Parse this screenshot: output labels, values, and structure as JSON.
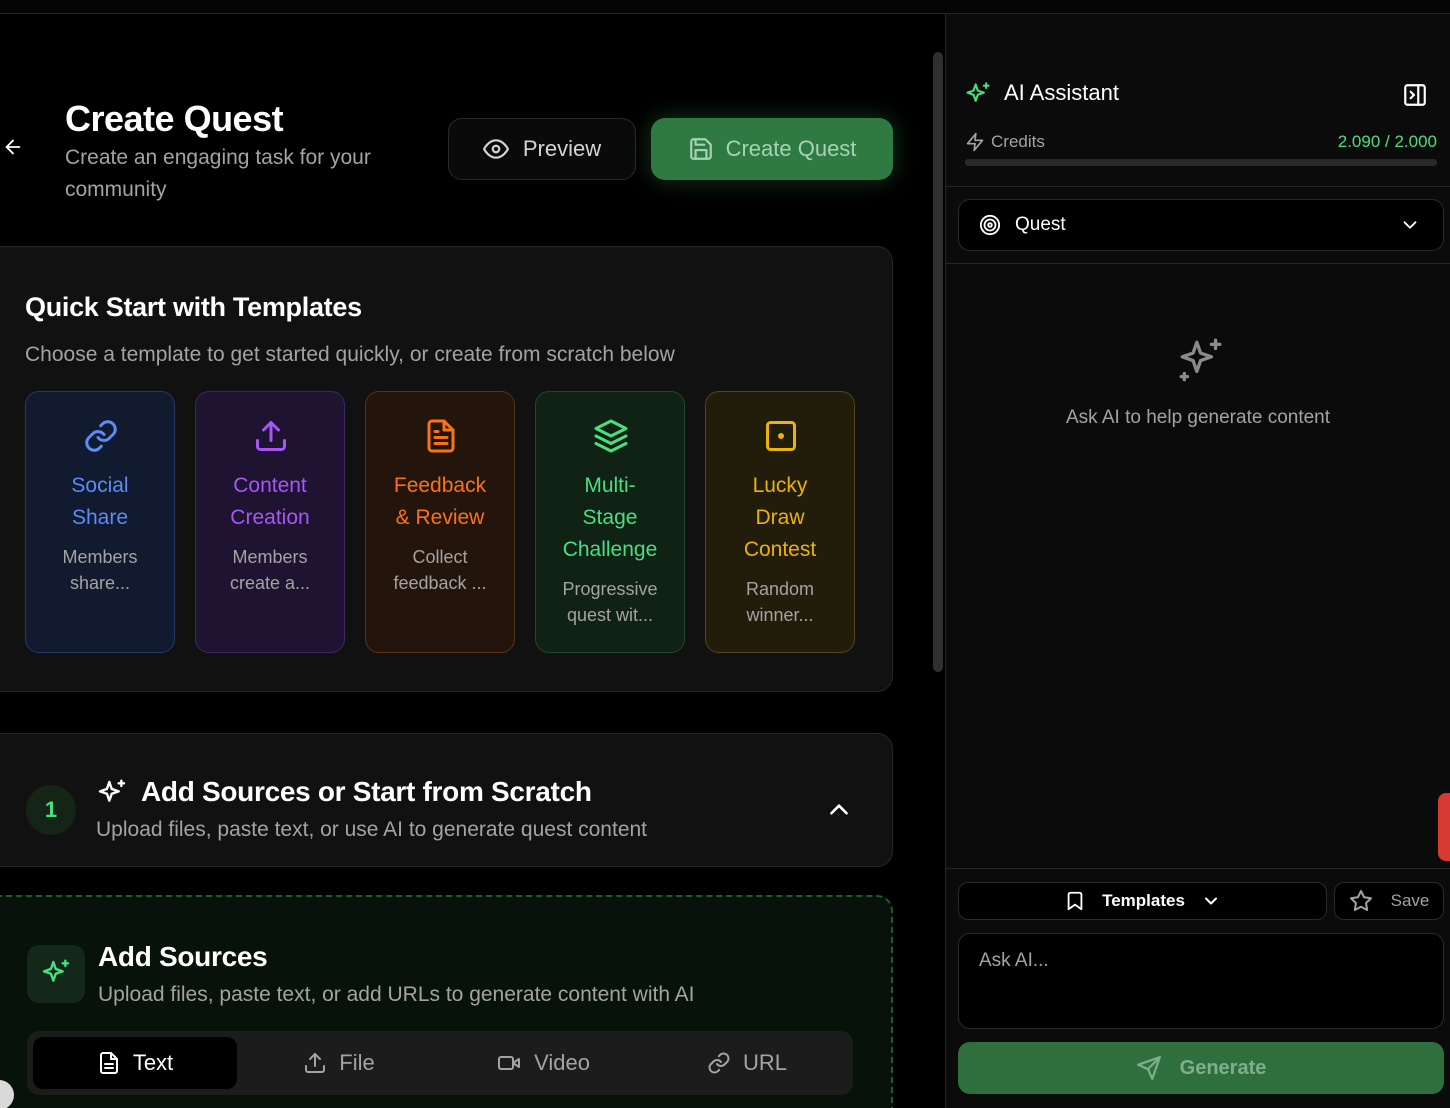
{
  "header": {
    "title": "Create Quest",
    "subtitle": "Create an engaging task for your community",
    "preview_label": "Preview",
    "create_label": "Create Quest"
  },
  "templates": {
    "title": "Quick Start with Templates",
    "subtitle": "Choose a template to get started quickly, or create from scratch below",
    "items": [
      {
        "name_lines": [
          "Social",
          "Share"
        ],
        "desc_lines": [
          "Members",
          "share..."
        ],
        "icon": "link-icon",
        "color": "#5b8cf7",
        "bg": "#111a2e",
        "border": "#243a66"
      },
      {
        "name_lines": [
          "Content",
          "Creation"
        ],
        "desc_lines": [
          "Members",
          "create a..."
        ],
        "icon": "upload-icon",
        "color": "#a855f7",
        "bg": "#1e1330",
        "border": "#3f2766"
      },
      {
        "name_lines": [
          "Feedback",
          "& Review"
        ],
        "desc_lines": [
          "Collect",
          "feedback ..."
        ],
        "icon": "document-icon",
        "color": "#f97316",
        "bg": "#24150c",
        "border": "#5a3218"
      },
      {
        "name_lines": [
          "Multi-",
          "Stage",
          "Challenge"
        ],
        "desc_lines": [
          "Progressive",
          "quest wit..."
        ],
        "icon": "layers-icon",
        "color": "#4ade80",
        "bg": "#0f2214",
        "border": "#1f4a2a"
      },
      {
        "name_lines": [
          "Lucky",
          "Draw",
          "Contest"
        ],
        "desc_lines": [
          "Random",
          "winner..."
        ],
        "icon": "dice-icon",
        "color": "#eab308",
        "bg": "#221c0b",
        "border": "#54451a"
      }
    ]
  },
  "step1": {
    "number": "1",
    "title": "Add Sources or Start from Scratch",
    "subtitle": "Upload files, paste text, or use AI to generate quest content"
  },
  "add_sources": {
    "title": "Add Sources",
    "subtitle": "Upload files, paste text, or add URLs to generate content with AI",
    "tabs": [
      {
        "label": "Text",
        "icon": "text-file-icon",
        "active": true
      },
      {
        "label": "File",
        "icon": "upload-icon",
        "active": false
      },
      {
        "label": "Video",
        "icon": "video-icon",
        "active": false
      },
      {
        "label": "URL",
        "icon": "link-icon",
        "active": false
      }
    ]
  },
  "assistant": {
    "title": "AI Assistant",
    "credits_label": "Credits",
    "credits_value": "2.090 / 2.000",
    "credits_fraction": 1.0,
    "mode_selected": "Quest",
    "empty_text": "Ask AI to help generate content",
    "templates_label": "Templates",
    "save_label": "Save",
    "input_placeholder": "Ask AI...",
    "generate_label": "Generate"
  },
  "colors": {
    "accent": "#2f7a43",
    "credits": "#4ade80"
  }
}
